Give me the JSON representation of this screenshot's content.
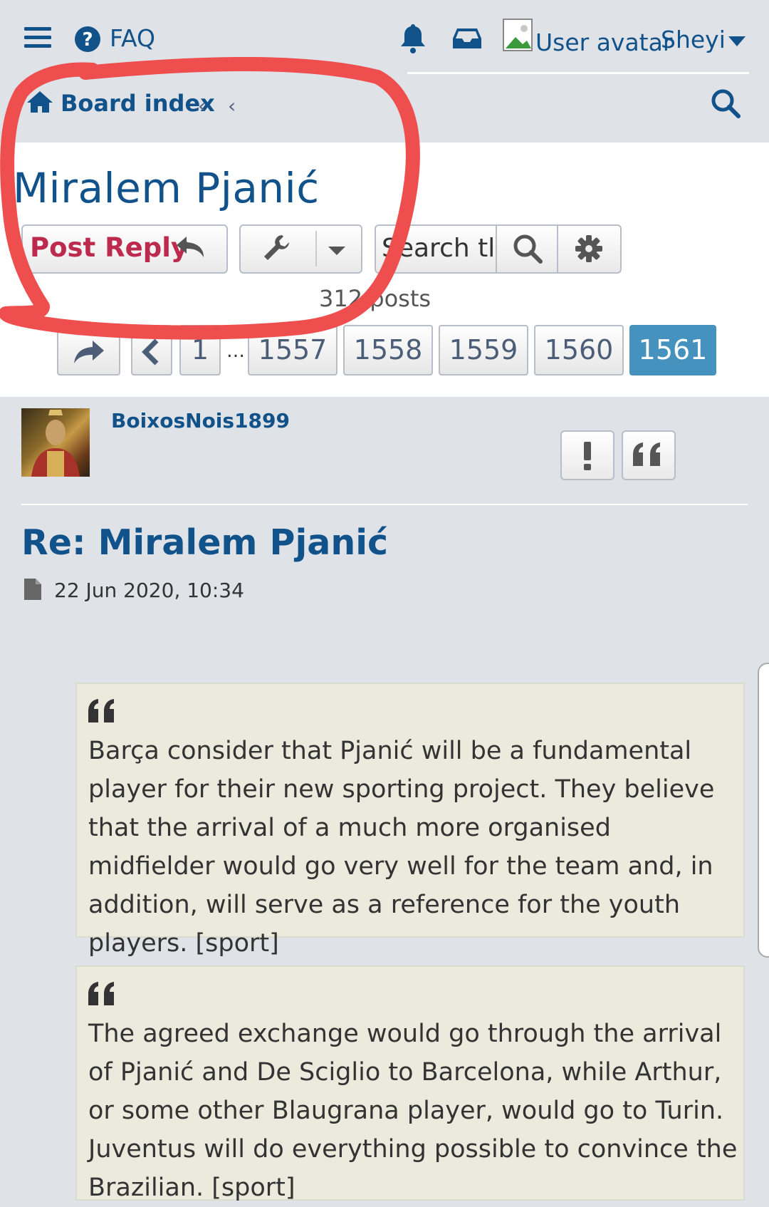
{
  "header": {
    "faq_label": "FAQ",
    "user_avatar_alt": "User avatar",
    "user_name": "Sheyi",
    "breadcrumb": {
      "board_index": "Board index",
      "separator": "‹"
    }
  },
  "topic": {
    "title": "Miralem Pjanić",
    "post_reply_label": "Post Reply",
    "search_placeholder": "Search tl",
    "post_count": "312  posts",
    "pagination": {
      "pages": [
        "1",
        "1557",
        "1558",
        "1559",
        "1560",
        "1561"
      ],
      "ellipsis": "…",
      "active_page": "1561"
    }
  },
  "post": {
    "author": "BoixosNois1899",
    "title": "Re: Miralem Pjanić",
    "date": "22 Jun 2020, 10:34",
    "quotes": [
      "Barça consider that Pjanić will be a fundamental player for their new sporting project. They believe that the arrival of a much more organised midfielder would go very well for the team and, in addition, will serve as a reference for the youth players. [sport]",
      "The agreed exchange would go through the arrival of Pjanić and De Sciglio to Barcelona, while Arthur, or some other Blaugrana player, would go to Turin. Juventus will do everything possible to convince the Brazilian. [sport]"
    ]
  },
  "colors": {
    "link_blue": "#105289",
    "post_reply_red": "#bc2a4d",
    "active_page_blue": "#4692bf",
    "annotation_red": "#ee4e4e",
    "quote_background": "#ebeadd"
  }
}
